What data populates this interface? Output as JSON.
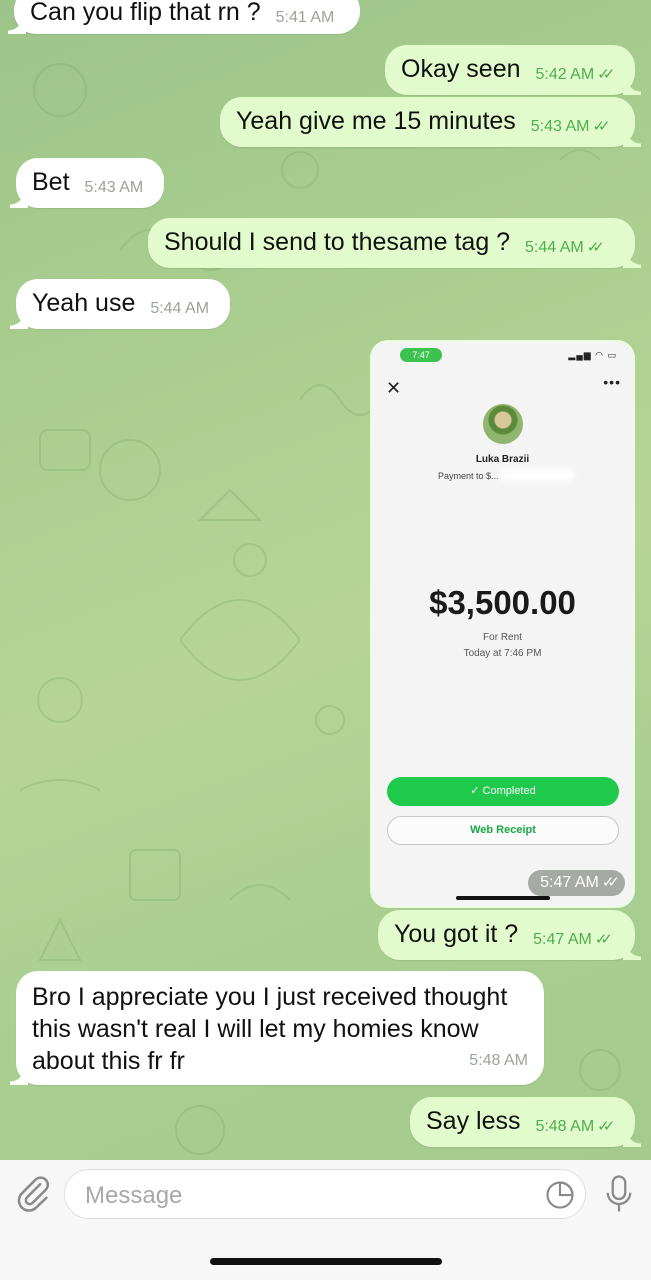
{
  "messages": [
    {
      "dir": "in",
      "text": "Can you flip that rn ?",
      "time": "5:41 AM"
    },
    {
      "dir": "out",
      "text": "Okay seen",
      "time": "5:42 AM"
    },
    {
      "dir": "out",
      "text": "Yeah give me 15 minutes",
      "time": "5:43 AM"
    },
    {
      "dir": "in",
      "text": "Bet",
      "time": "5:43 AM"
    },
    {
      "dir": "out",
      "text": "Should I send to thesame tag ?",
      "time": "5:44 AM"
    },
    {
      "dir": "in",
      "text": "Yeah use",
      "time": "5:44 AM"
    },
    {
      "dir": "out",
      "text": "You got it ?",
      "time": "5:47 AM"
    },
    {
      "dir": "in",
      "text": "Bro I appreciate you I just received thought this wasn't real I will let my homies know about this fr fr",
      "time": "5:48 AM"
    },
    {
      "dir": "out",
      "text": "Say less",
      "time": "5:48 AM"
    }
  ],
  "receipt": {
    "time": "5:47 AM",
    "status_time": "7:47",
    "name": "Luka Brazii",
    "payment_to": "Payment to $...",
    "amount": "$3,500.00",
    "for": "For Rent",
    "date": "Today at 7:46 PM",
    "completed_label": "Completed",
    "receipt_label": "Web Receipt",
    "close_icon": "close-icon",
    "more_icon": "more-icon"
  },
  "composer": {
    "placeholder": "Message",
    "attach_icon": "paperclip-icon",
    "sticker_icon": "sticker-icon",
    "mic_icon": "microphone-icon"
  },
  "colors": {
    "outgoing_bubble": "#e2fbcc",
    "incoming_bubble": "#ffffff",
    "timestamp_out": "#4fae4e",
    "cash_green": "#1ec94c"
  }
}
